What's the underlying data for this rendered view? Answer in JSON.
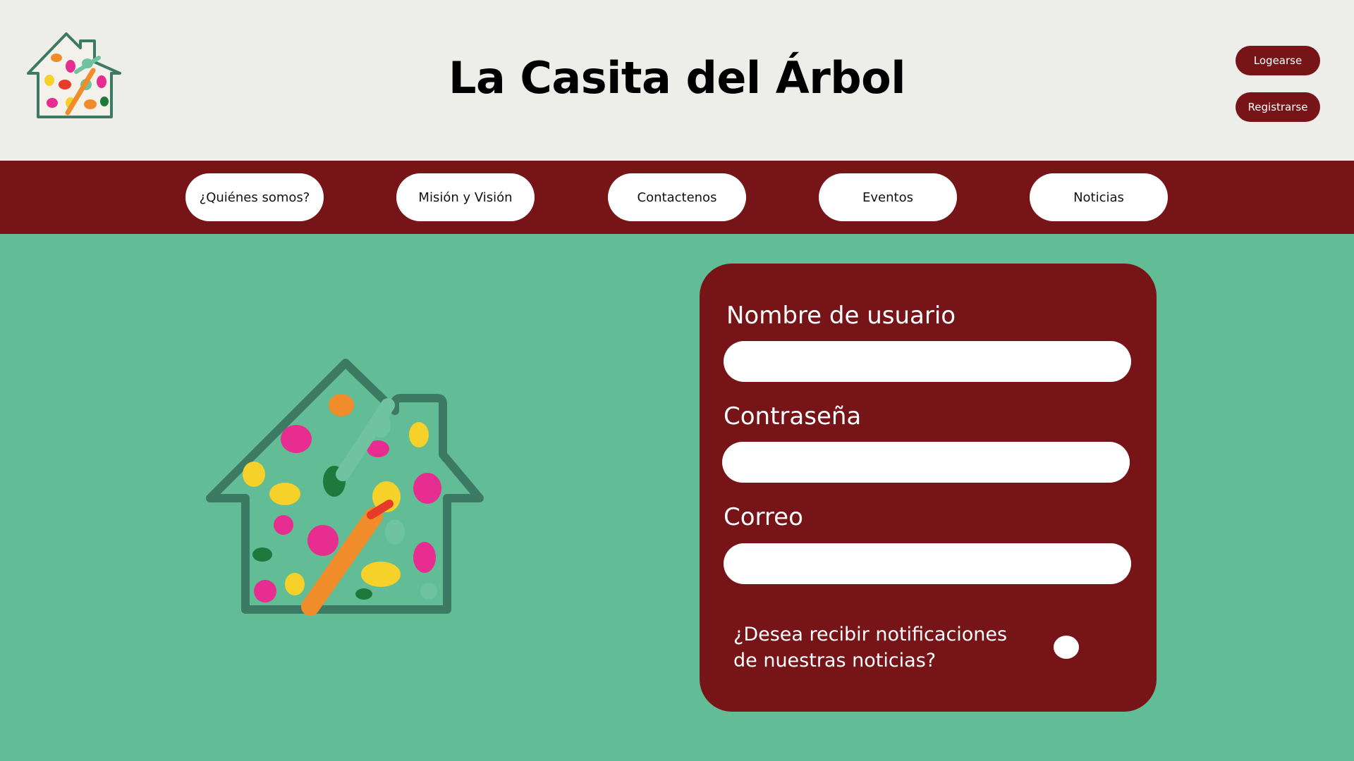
{
  "header": {
    "title": "La Casita del Árbol",
    "logo_icon": "house-hands-logo-icon",
    "login_label": "Logearse",
    "register_label": "Registrarse"
  },
  "nav": {
    "items": [
      {
        "label": "¿Quiénes somos?"
      },
      {
        "label": "Misión y Visión"
      },
      {
        "label": "Contactenos"
      },
      {
        "label": "Eventos"
      },
      {
        "label": "Noticias"
      }
    ]
  },
  "hero": {
    "image_icon": "house-hands-illustration-icon"
  },
  "form": {
    "username_label": "Nombre de usuario",
    "username_value": "",
    "password_label": "Contraseña",
    "password_value": "",
    "email_label": "Correo",
    "email_value": "",
    "notify_text": "¿Desea recibir notificaciones de nuestras noticias?",
    "notify_enabled": false
  },
  "colors": {
    "header_bg": "#ededea",
    "accent": "#771417",
    "page_bg": "#62bc95",
    "house_outline": "#3d7a64"
  }
}
